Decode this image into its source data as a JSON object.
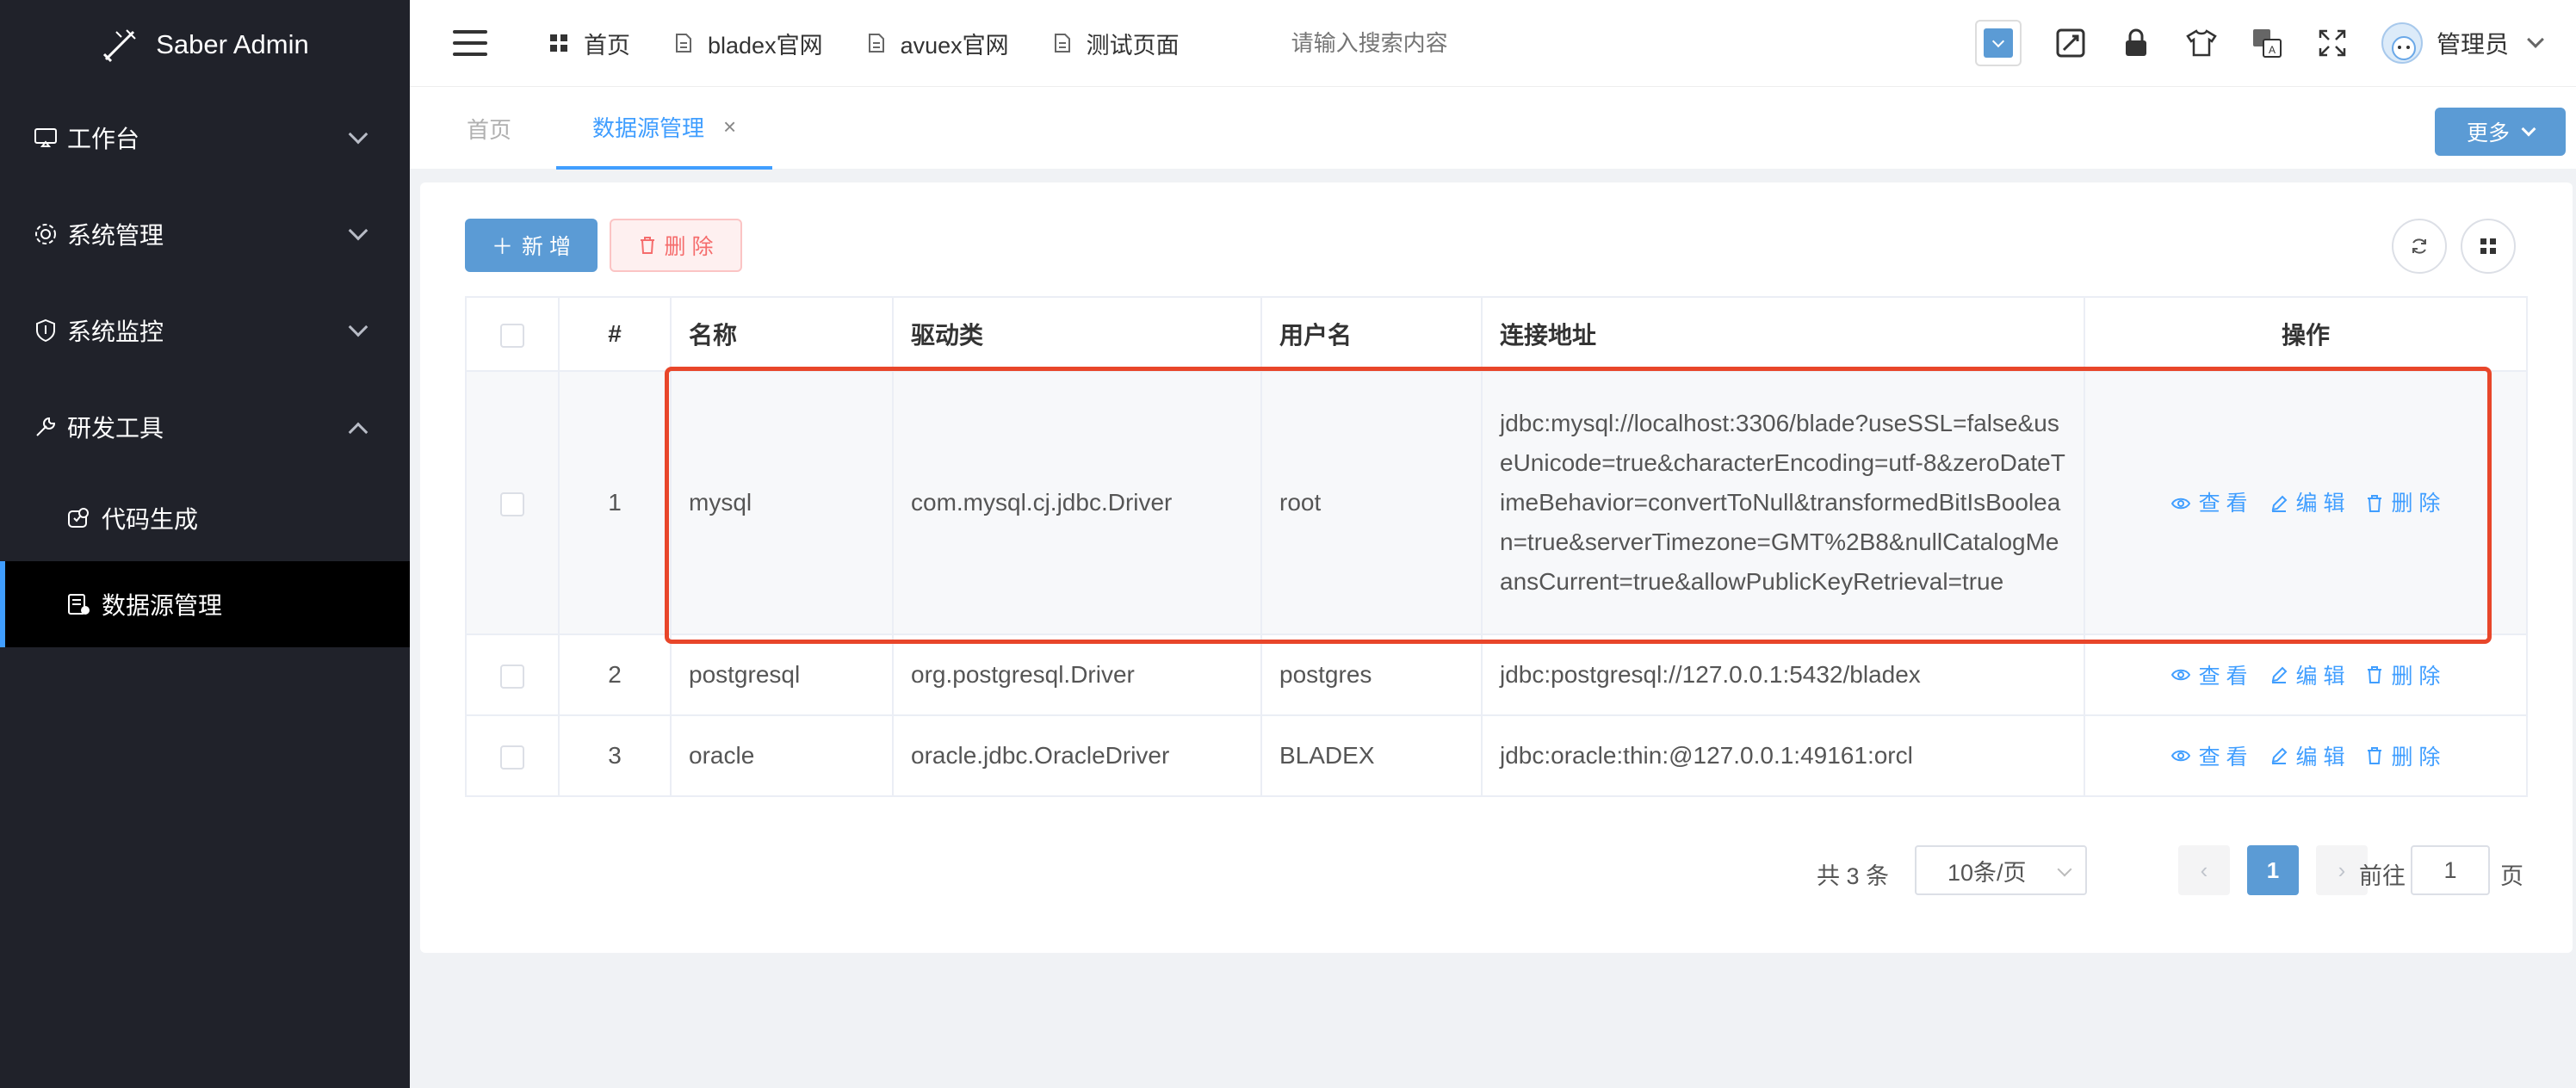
{
  "app": {
    "title": "Saber Admin"
  },
  "sidebar": {
    "items": [
      {
        "label": "工作台",
        "icon": "monitor-icon",
        "expanded": false
      },
      {
        "label": "系统管理",
        "icon": "gear-icon",
        "expanded": false
      },
      {
        "label": "系统监控",
        "icon": "shield-icon",
        "expanded": false
      },
      {
        "label": "研发工具",
        "icon": "wrench-icon",
        "expanded": true
      }
    ],
    "subitems": [
      {
        "label": "代码生成",
        "icon": "code-icon",
        "active": false
      },
      {
        "label": "数据源管理",
        "icon": "datasource-icon",
        "active": true
      }
    ]
  },
  "topnav": {
    "links": [
      {
        "label": "首页",
        "icon": "grid-icon"
      },
      {
        "label": "bladex官网",
        "icon": "document-icon"
      },
      {
        "label": "avuex官网",
        "icon": "document-icon"
      },
      {
        "label": "测试页面",
        "icon": "document-icon"
      }
    ],
    "search_placeholder": "请输入搜索内容",
    "user_name": "管理员",
    "theme_color": "#5b9bd5"
  },
  "tabs": {
    "home_label": "首页",
    "active_label": "数据源管理",
    "close_glyph": "×",
    "more_label": "更多"
  },
  "toolbar": {
    "add_label": "新 增",
    "delete_label": "删 除"
  },
  "table": {
    "headers": [
      "#",
      "名称",
      "驱动类",
      "用户名",
      "连接地址",
      "操作"
    ],
    "rows": [
      {
        "index": "1",
        "name": "mysql",
        "driver": "com.mysql.cj.jdbc.Driver",
        "username": "root",
        "url": "jdbc:mysql://localhost:3306/blade?useSSL=false&useUnicode=true&characterEncoding=utf-8&zeroDateTimeBehavior=convertToNull&transformedBitIsBoolean=true&serverTimezone=GMT%2B8&nullCatalogMeansCurrent=true&allowPublicKeyRetrieval=true"
      },
      {
        "index": "2",
        "name": "postgresql",
        "driver": "org.postgresql.Driver",
        "username": "postgres",
        "url": "jdbc:postgresql://127.0.0.1:5432/bladex"
      },
      {
        "index": "3",
        "name": "oracle",
        "driver": "oracle.jdbc.OracleDriver",
        "username": "BLADEX",
        "url": "jdbc:oracle:thin:@127.0.0.1:49161:orcl"
      }
    ],
    "actions": {
      "view": "查 看",
      "edit": "编 辑",
      "delete": "删 除"
    },
    "highlight_color": "#e8462a"
  },
  "pagination": {
    "total_text": "共 3 条",
    "page_size": "10条/页",
    "prev": "‹",
    "current": "1",
    "next": "›",
    "goto_label": "前往",
    "goto_value": "1",
    "page_suffix": "页"
  }
}
